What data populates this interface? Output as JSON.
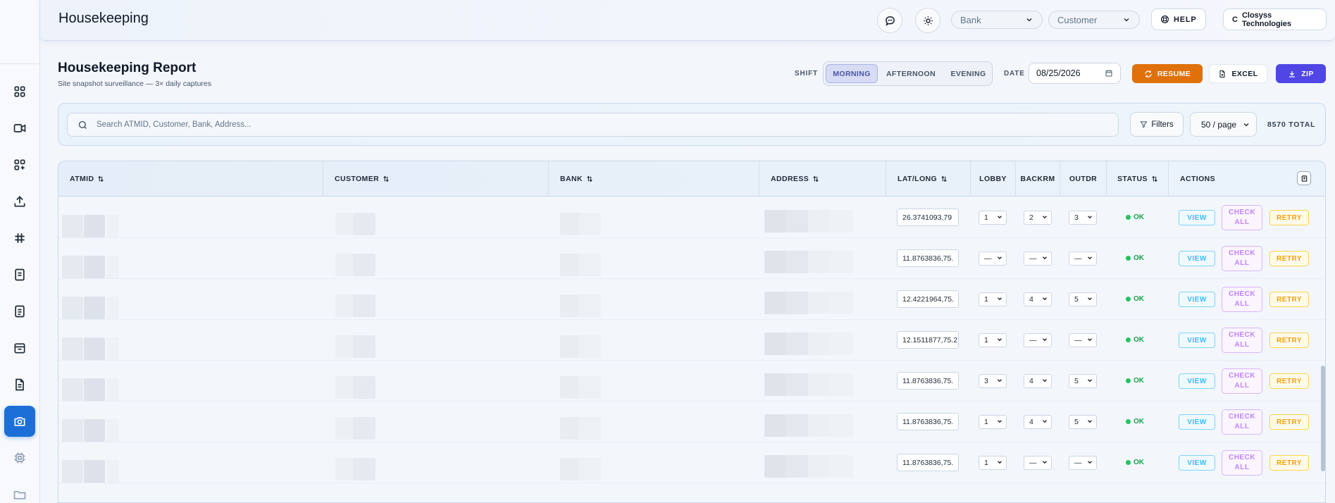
{
  "app": {
    "title": "Housekeeping"
  },
  "header": {
    "bank_select": "Bank",
    "customer_select": "Customer",
    "help_label": "HELP",
    "org_label": "Closyss Technologies",
    "org_initial": "C"
  },
  "sidebar": {
    "icons": [
      "dashboard-icon",
      "video-icon",
      "apps-add-icon",
      "upload-icon",
      "grid-icon",
      "report-icon",
      "report-alt-icon",
      "calendar-icon",
      "document-icon",
      "camera-icon",
      "chip-icon",
      "folder-icon"
    ],
    "active": "camera-icon"
  },
  "report": {
    "title": "Housekeeping Report",
    "subtitle": "Site snapshot surveillance — 3× daily captures",
    "shift_label": "SHIFT",
    "shifts": [
      "MORNING",
      "AFTERNOON",
      "EVENING"
    ],
    "active_shift": "MORNING",
    "date_label": "DATE",
    "date_value": "08/25/2026",
    "resume_label": "RESUME",
    "excel_label": "EXCEL",
    "zip_label": "ZIP"
  },
  "search": {
    "placeholder": "Search ATMID, Customer, Bank, Address...",
    "filters_label": "Filters",
    "per_page": "50 / page",
    "total": "8570 TOTAL"
  },
  "table": {
    "columns": [
      "ATMID",
      "CUSTOMER",
      "BANK",
      "ADDRESS",
      "LAT/LONG",
      "LOBBY",
      "BACKRM",
      "OUTDR",
      "STATUS",
      "ACTIONS"
    ],
    "rows": [
      {
        "latlong": "26.3741093,79",
        "lobby": "1",
        "backrm": "2",
        "outdr": "3",
        "status": "OK"
      },
      {
        "latlong": "11.8763836,75.",
        "lobby": "—",
        "backrm": "—",
        "outdr": "—",
        "status": "OK"
      },
      {
        "latlong": "12.4221964,75.",
        "lobby": "1",
        "backrm": "4",
        "outdr": "5",
        "status": "OK"
      },
      {
        "latlong": "12.1511877,75.2",
        "lobby": "1",
        "backrm": "—",
        "outdr": "—",
        "status": "OK"
      },
      {
        "latlong": "11.8763836,75.",
        "lobby": "3",
        "backrm": "4",
        "outdr": "5",
        "status": "OK"
      },
      {
        "latlong": "11.8763836,75.",
        "lobby": "1",
        "backrm": "4",
        "outdr": "5",
        "status": "OK"
      },
      {
        "latlong": "11.8763836,75.",
        "lobby": "1",
        "backrm": "—",
        "outdr": "—",
        "status": "OK"
      }
    ],
    "actions": {
      "view": "VIEW",
      "check_all": "CHECK ALL",
      "retry": "RETRY"
    }
  },
  "colors": {
    "primary": "#1d6fd8",
    "resume": "#e0700a",
    "zip": "#4f46e5",
    "ok": "#16a34a"
  }
}
